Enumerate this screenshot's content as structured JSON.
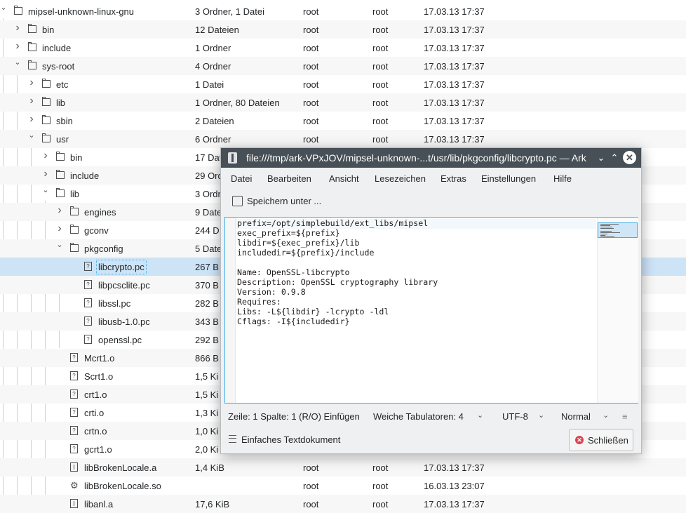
{
  "tree": {
    "rows": [
      {
        "name": "mipsel-unknown-linux-gnu",
        "size": "3 Ordner, 1 Datei",
        "owner": "root",
        "group": "root",
        "date": "17.03.13 17:37",
        "icon": "folder-icon",
        "expander": "expanded"
      },
      {
        "name": "bin",
        "size": "12 Dateien",
        "owner": "root",
        "group": "root",
        "date": "17.03.13 17:37",
        "icon": "folder-icon",
        "expander": "collapsed"
      },
      {
        "name": "include",
        "size": "1 Ordner",
        "owner": "root",
        "group": "root",
        "date": "17.03.13 17:37",
        "icon": "folder-icon",
        "expander": "collapsed"
      },
      {
        "name": "sys-root",
        "size": "4 Ordner",
        "owner": "root",
        "group": "root",
        "date": "17.03.13 17:37",
        "icon": "folder-icon",
        "expander": "expanded"
      },
      {
        "name": "etc",
        "size": "1 Datei",
        "owner": "root",
        "group": "root",
        "date": "17.03.13 17:37",
        "icon": "folder-icon",
        "expander": "collapsed"
      },
      {
        "name": "lib",
        "size": "1 Ordner, 80 Dateien",
        "owner": "root",
        "group": "root",
        "date": "17.03.13 17:37",
        "icon": "folder-icon",
        "expander": "collapsed"
      },
      {
        "name": "sbin",
        "size": "2 Dateien",
        "owner": "root",
        "group": "root",
        "date": "17.03.13 17:37",
        "icon": "folder-icon",
        "expander": "collapsed"
      },
      {
        "name": "usr",
        "size": "6 Ordner",
        "owner": "root",
        "group": "root",
        "date": "17.03.13 17:37",
        "icon": "folder-icon",
        "expander": "expanded"
      },
      {
        "name": "bin",
        "size": "17 Dat",
        "owner": "",
        "group": "",
        "date": "",
        "icon": "folder-icon",
        "expander": "collapsed"
      },
      {
        "name": "include",
        "size": "29 Ord",
        "owner": "",
        "group": "",
        "date": "",
        "icon": "folder-icon",
        "expander": "collapsed"
      },
      {
        "name": "lib",
        "size": "3 Ordn",
        "owner": "",
        "group": "",
        "date": "",
        "icon": "folder-icon",
        "expander": "expanded"
      },
      {
        "name": "engines",
        "size": "9 Date",
        "owner": "",
        "group": "",
        "date": "",
        "icon": "folder-icon",
        "expander": "collapsed"
      },
      {
        "name": "gconv",
        "size": "244 D",
        "owner": "",
        "group": "",
        "date": "",
        "icon": "folder-icon",
        "expander": "collapsed"
      },
      {
        "name": "pkgconfig",
        "size": "5 Date",
        "owner": "",
        "group": "",
        "date": "",
        "icon": "folder-icon",
        "expander": "expanded"
      },
      {
        "name": "libcrypto.pc",
        "size": "267 B",
        "owner": "",
        "group": "",
        "date": "",
        "icon": "file-unknown-icon",
        "expander": "none"
      },
      {
        "name": "libpcsclite.pc",
        "size": "370 B",
        "owner": "",
        "group": "",
        "date": "",
        "icon": "file-unknown-icon",
        "expander": "none"
      },
      {
        "name": "libssl.pc",
        "size": "282 B",
        "owner": "",
        "group": "",
        "date": "",
        "icon": "file-unknown-icon",
        "expander": "none"
      },
      {
        "name": "libusb-1.0.pc",
        "size": "343 B",
        "owner": "",
        "group": "",
        "date": "",
        "icon": "file-unknown-icon",
        "expander": "none"
      },
      {
        "name": "openssl.pc",
        "size": "292 B",
        "owner": "",
        "group": "",
        "date": "",
        "icon": "file-unknown-icon",
        "expander": "none"
      },
      {
        "name": "Mcrt1.o",
        "size": "866 B",
        "owner": "",
        "group": "",
        "date": "",
        "icon": "file-unknown-icon",
        "expander": "none"
      },
      {
        "name": "Scrt1.o",
        "size": "1,5 Ki",
        "owner": "",
        "group": "",
        "date": "",
        "icon": "file-unknown-icon",
        "expander": "none"
      },
      {
        "name": "crt1.o",
        "size": "1,5 Ki",
        "owner": "",
        "group": "",
        "date": "",
        "icon": "file-unknown-icon",
        "expander": "none"
      },
      {
        "name": "crti.o",
        "size": "1,3 Ki",
        "owner": "",
        "group": "",
        "date": "",
        "icon": "file-unknown-icon",
        "expander": "none"
      },
      {
        "name": "crtn.o",
        "size": "1,0 Ki",
        "owner": "",
        "group": "",
        "date": "",
        "icon": "file-unknown-icon",
        "expander": "none"
      },
      {
        "name": "gcrt1.o",
        "size": "2,0 Ki",
        "owner": "",
        "group": "",
        "date": "",
        "icon": "file-unknown-icon",
        "expander": "none"
      },
      {
        "name": "libBrokenLocale.a",
        "size": "1,4 KiB",
        "owner": "root",
        "group": "root",
        "date": "17.03.13 17:37",
        "icon": "library-icon",
        "expander": "none"
      },
      {
        "name": "libBrokenLocale.so",
        "size": "",
        "owner": "root",
        "group": "root",
        "date": "16.03.13 23:07",
        "icon": "gear-icon",
        "expander": "none"
      },
      {
        "name": "libanl.a",
        "size": "17,6 KiB",
        "owner": "root",
        "group": "root",
        "date": "17.03.13 17:37",
        "icon": "library-icon",
        "expander": "none"
      }
    ]
  },
  "window": {
    "title": "file:///tmp/ark-VPxJOV/mipsel-unknown-...t/usr/lib/pkgconfig/libcrypto.pc — Ark",
    "menu": [
      "Datei",
      "Bearbeiten",
      "Ansicht",
      "Lesezeichen",
      "Extras",
      "Einstellungen",
      "Hilfe"
    ],
    "save_as": "Speichern unter ...",
    "content": "prefix=/opt/simplebuild/ext_libs/mipsel\nexec_prefix=${prefix}\nlibdir=${exec_prefix}/lib\nincludedir=${prefix}/include\n\nName: OpenSSL-libcrypto\nDescription: OpenSSL cryptography library\nVersion: 0.9.8\nRequires:\nLibs: -L${libdir} -lcrypto -ldl\nCflags: -I${includedir}",
    "status": {
      "cursor": "Zeile: 1 Spalte: 1 (R/O) Einfügen",
      "tabs": "Weiche Tabulatoren: 4",
      "encoding": "UTF-8",
      "mode": "Normal"
    },
    "doc_type": "Einfaches Textdokument",
    "close_label": "Schließen"
  }
}
